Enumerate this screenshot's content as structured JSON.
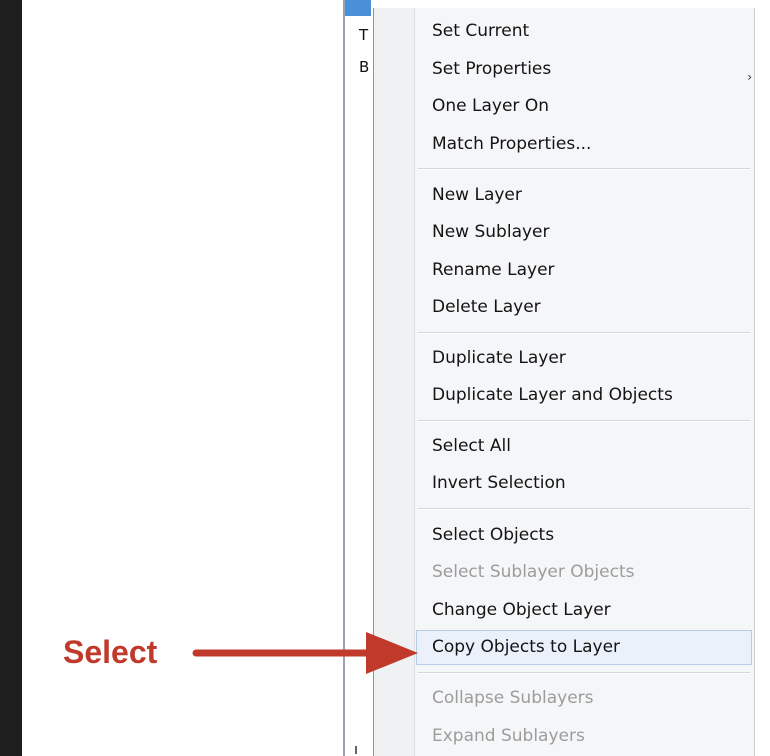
{
  "layers_panel": {
    "col_row1": "T",
    "col_row2": "B"
  },
  "context_menu": {
    "items": [
      {
        "label": "Set Current",
        "enabled": true
      },
      {
        "label": "Set Properties",
        "enabled": true,
        "has_submenu": true
      },
      {
        "label": "One Layer On",
        "enabled": true
      },
      {
        "label": "Match Properties...",
        "enabled": true
      },
      {
        "label": "New Layer",
        "enabled": true
      },
      {
        "label": "New Sublayer",
        "enabled": true
      },
      {
        "label": "Rename Layer",
        "enabled": true
      },
      {
        "label": "Delete Layer",
        "enabled": true
      },
      {
        "label": "Duplicate Layer",
        "enabled": true
      },
      {
        "label": "Duplicate Layer and Objects",
        "enabled": true
      },
      {
        "label": "Select All",
        "enabled": true
      },
      {
        "label": "Invert Selection",
        "enabled": true
      },
      {
        "label": "Select Objects",
        "enabled": true
      },
      {
        "label": "Select Sublayer Objects",
        "enabled": false
      },
      {
        "label": "Change Object Layer",
        "enabled": true
      },
      {
        "label": "Copy Objects to Layer",
        "enabled": true,
        "highlighted": true
      },
      {
        "label": "Collapse Sublayers",
        "enabled": false
      },
      {
        "label": "Expand Sublayers",
        "enabled": false
      }
    ],
    "submenu_glyph": "›"
  },
  "annotation": {
    "label": "Select",
    "color": "#c0392b"
  },
  "colors": {
    "highlight_bg": "#eaf1fb",
    "highlight_border": "#b9cce6",
    "disabled_text": "#9c9c9c",
    "left_bar": "#1e1e1e"
  }
}
